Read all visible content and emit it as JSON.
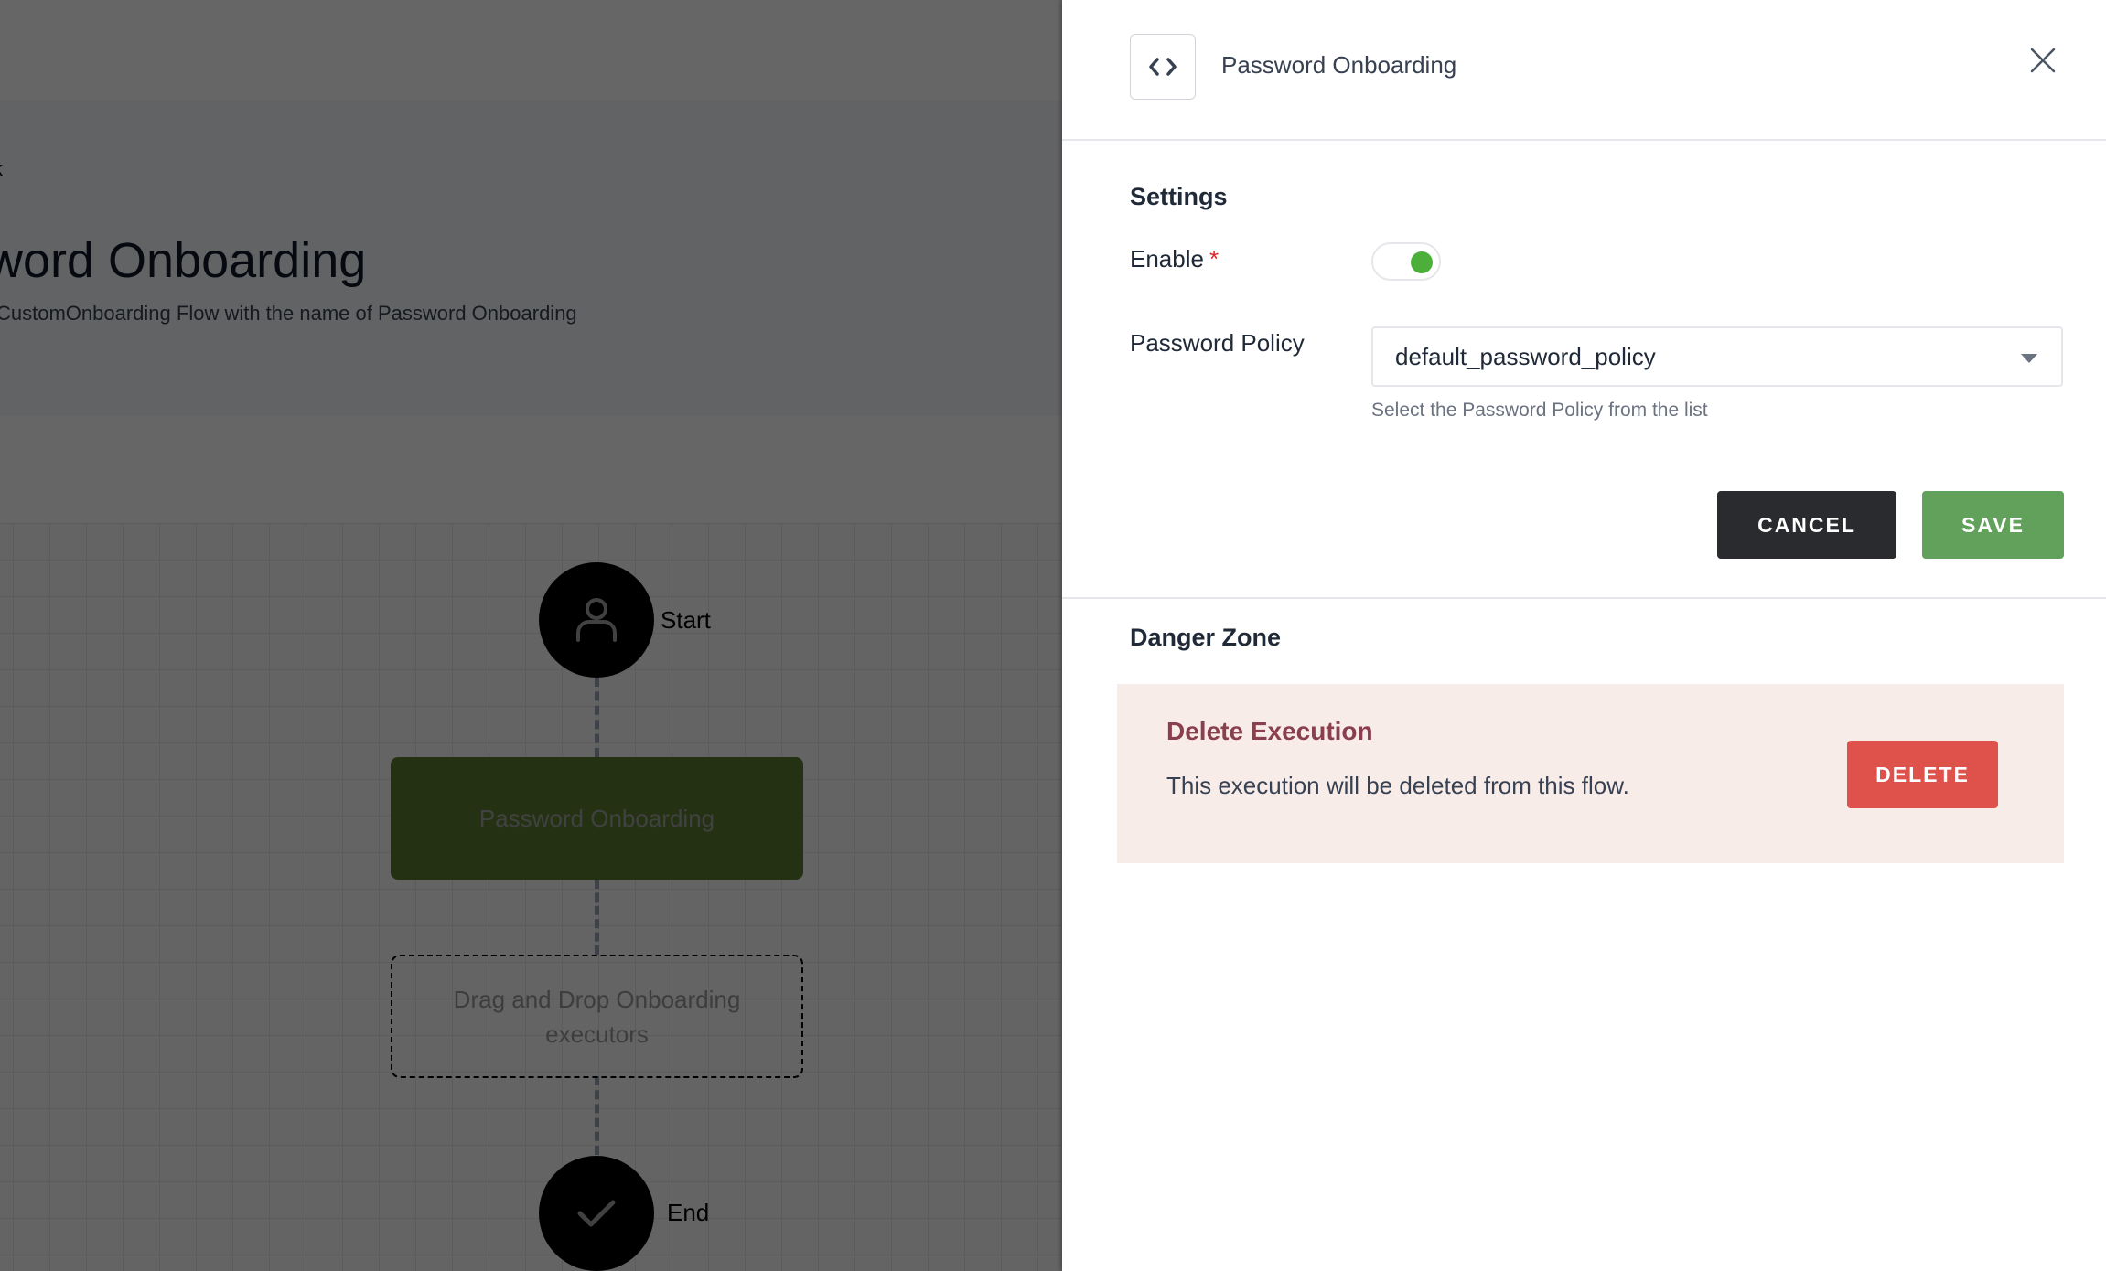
{
  "background": {
    "back_link": "k",
    "page_title": "word Onboarding",
    "page_subtitle": "CustomOnboarding Flow with the name of Password Onboarding",
    "flow": {
      "start_label": "Start",
      "start_icon": "user-icon",
      "executor_label": "Password Onboarding",
      "dropzone_label": "Drag and Drop Onboarding executors",
      "end_label": "End",
      "end_icon": "check-icon"
    }
  },
  "panel": {
    "header": {
      "icon": "code-icon",
      "title": "Password Onboarding",
      "close_icon": "close-icon"
    },
    "settings": {
      "title": "Settings",
      "enable_label": "Enable",
      "required_marker": "*",
      "enable_value": true,
      "policy_label": "Password Policy",
      "policy_value": "default_password_policy",
      "policy_helper": "Select the Password Policy from the list",
      "cancel_label": "CANCEL",
      "save_label": "SAVE"
    },
    "danger_zone": {
      "title": "Danger Zone",
      "card_title": "Delete Execution",
      "card_description": "This execution will be deleted from this flow.",
      "delete_label": "DELETE"
    }
  },
  "colors": {
    "save": "#62a15c",
    "cancel": "#2a2b2e",
    "delete": "#df524c",
    "danger_bg": "#f8ece9",
    "toggle_on": "#4caf3a",
    "executor_node": "#5d7a30"
  }
}
